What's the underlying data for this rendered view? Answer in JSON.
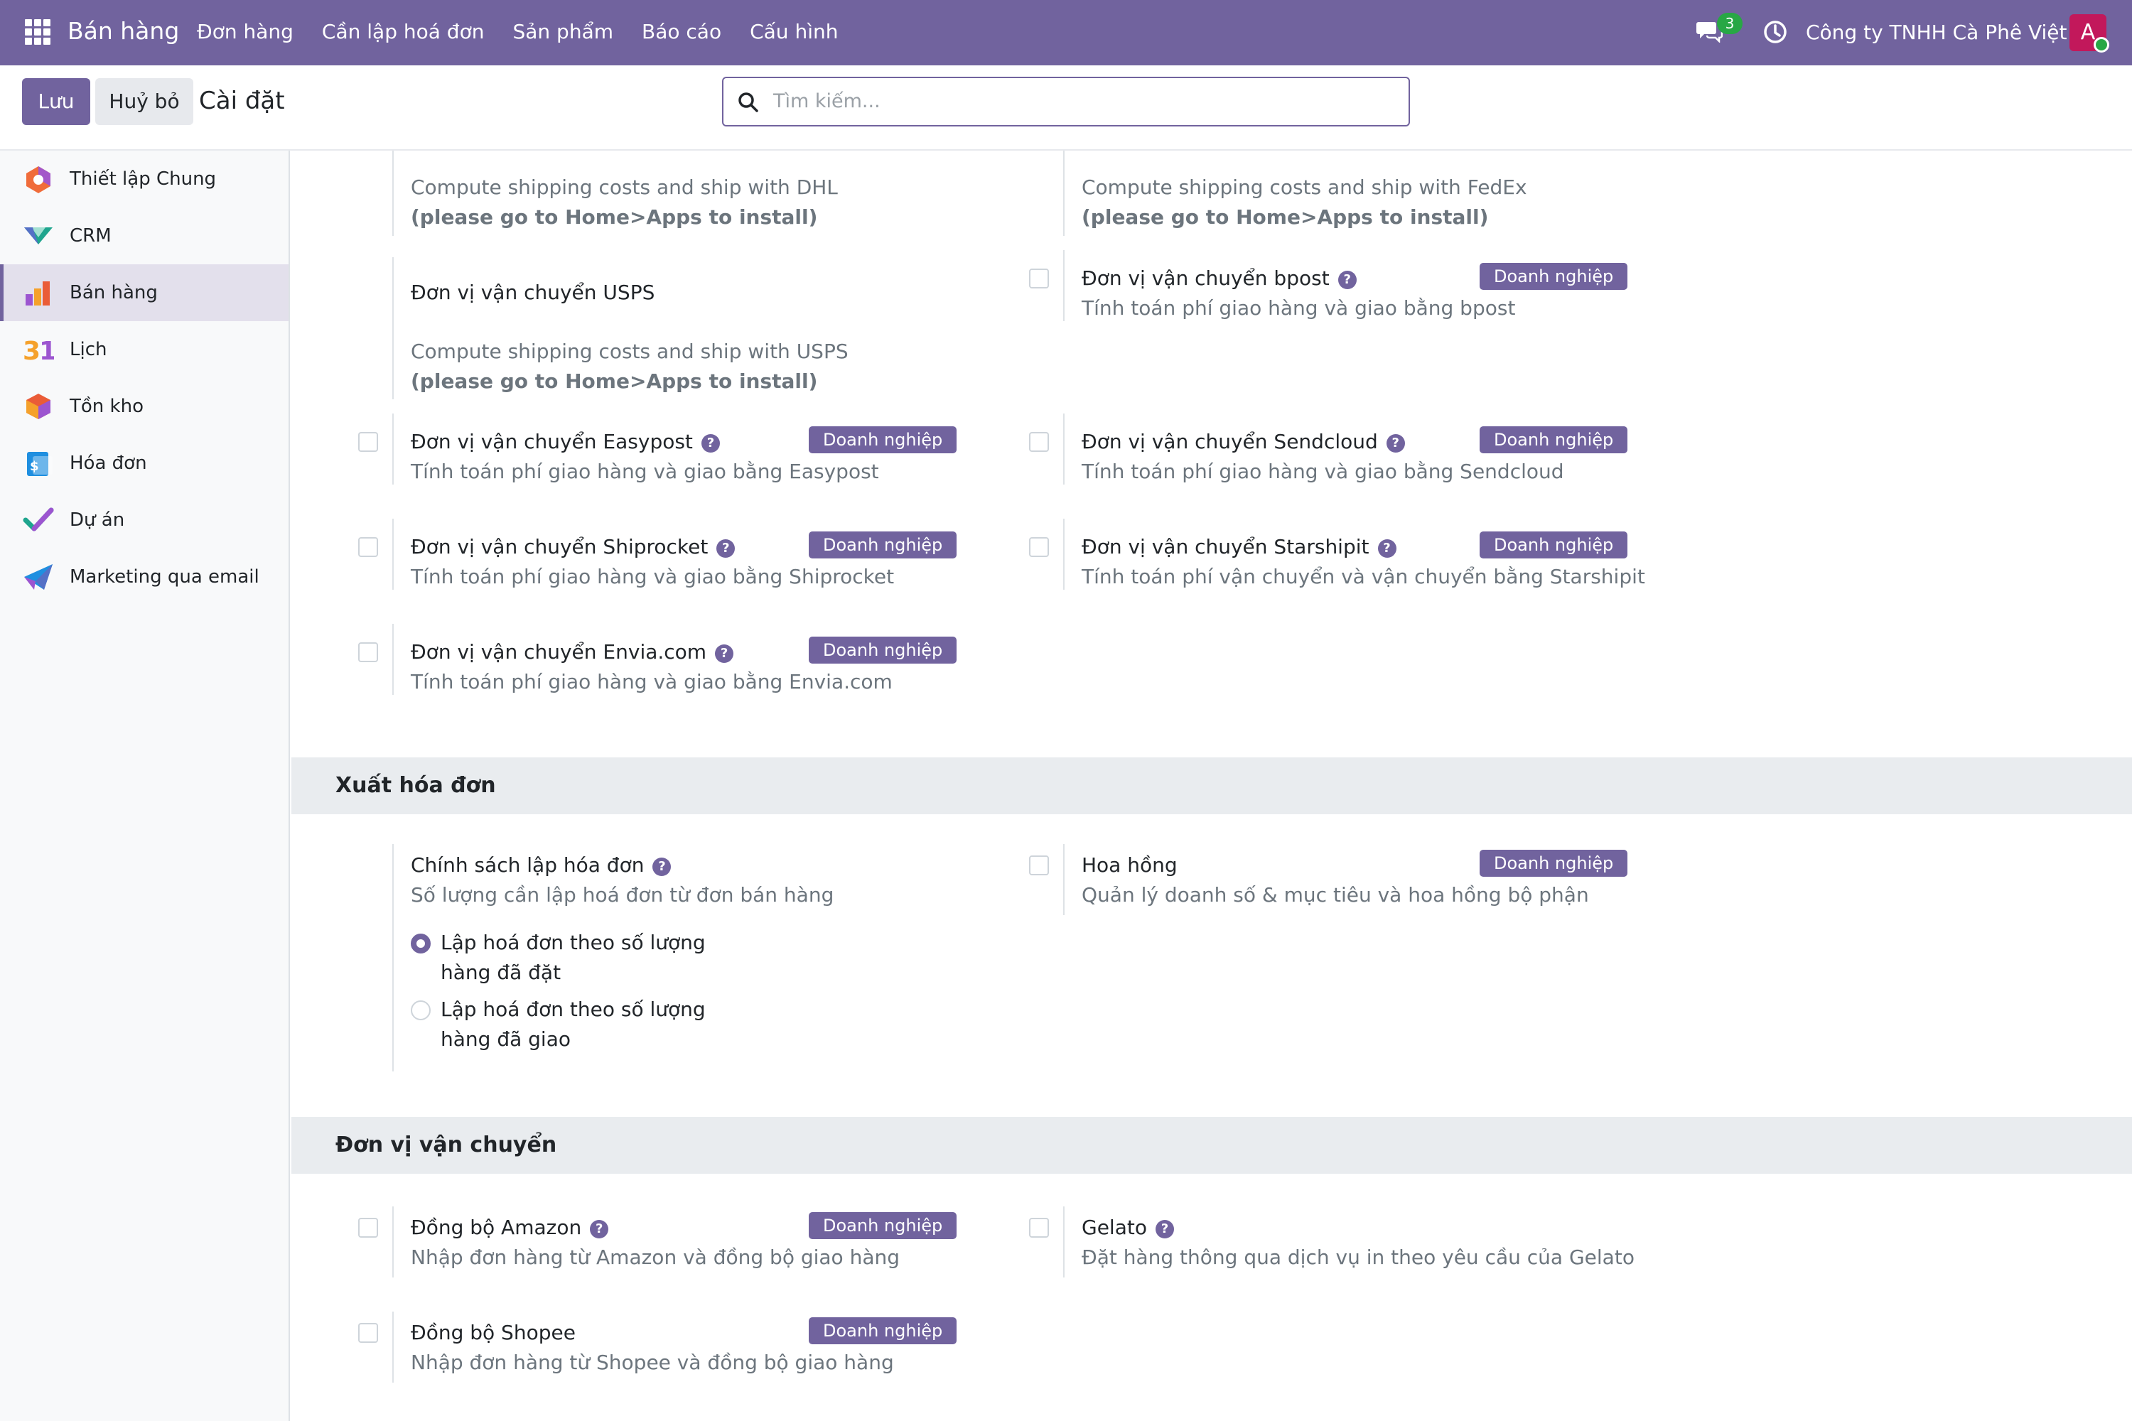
{
  "navbar": {
    "brand": "Bán hàng",
    "menu": [
      "Đơn hàng",
      "Cần lập hoá đơn",
      "Sản phẩm",
      "Báo cáo",
      "Cấu hình"
    ],
    "chat_count": "3",
    "company": "Công ty TNHH Cà Phê Việt",
    "avatar_letter": "A"
  },
  "control": {
    "save_label": "Lưu",
    "cancel_label": "Huỷ bỏ",
    "title": "Cài đặt",
    "search_placeholder": "Tìm kiếm..."
  },
  "sidebar": {
    "items": [
      {
        "label": "Thiết lập Chung",
        "icon": "settings-hexagon-icon"
      },
      {
        "label": "CRM",
        "icon": "crm-icon"
      },
      {
        "label": "Bán hàng",
        "icon": "sales-icon",
        "active": true
      },
      {
        "label": "Lịch",
        "icon": "calendar-icon"
      },
      {
        "label": "Tồn kho",
        "icon": "inventory-icon"
      },
      {
        "label": "Hóa đơn",
        "icon": "invoice-icon"
      },
      {
        "label": "Dự án",
        "icon": "project-icon"
      },
      {
        "label": "Marketing qua email",
        "icon": "email-marketing-icon"
      }
    ]
  },
  "shipping": {
    "dhl_desc": "Compute shipping costs and ship with DHL",
    "dhl_note": "(please go to Home>Apps to install)",
    "fedex_desc": "Compute shipping costs and ship with FedEx",
    "fedex_note": "(please go to Home>Apps to install)",
    "usps_title": "Đơn vị vận chuyển USPS",
    "usps_desc": "Compute shipping costs and ship with USPS",
    "usps_note": "(please go to Home>Apps to install)",
    "bpost_title": "Đơn vị vận chuyển bpost",
    "bpost_desc": "Tính toán phí giao hàng và giao bằng bpost",
    "easypost_title": "Đơn vị vận chuyển Easypost",
    "easypost_desc": "Tính toán phí giao hàng và giao bằng Easypost",
    "sendcloud_title": "Đơn vị vận chuyển Sendcloud",
    "sendcloud_desc": "Tính toán phí giao hàng và giao bằng Sendcloud",
    "shiprocket_title": "Đơn vị vận chuyển Shiprocket",
    "shiprocket_desc": "Tính toán phí giao hàng và giao bằng Shiprocket",
    "starshipit_title": "Đơn vị vận chuyển Starshipit",
    "starshipit_desc": "Tính toán phí vận chuyển và vận chuyển bằng Starshipit",
    "envia_title": "Đơn vị vận chuyển Envia.com",
    "envia_desc": "Tính toán phí giao hàng và giao bằng Envia.com"
  },
  "badge_label": "Doanh nghiệp",
  "invoicing": {
    "header": "Xuất hóa đơn",
    "policy_title": "Chính sách lập hóa đơn",
    "policy_desc": "Số lượng cần lập hoá đơn từ đơn bán hàng",
    "option_ordered": "Lập hoá đơn theo số lượng hàng đã đặt",
    "option_delivered": "Lập hoá đơn theo số lượng hàng đã giao",
    "selected": "ordered",
    "commission_title": "Hoa hồng",
    "commission_desc": "Quản lý doanh số & mục tiêu và hoa hồng bộ phận"
  },
  "connectors": {
    "header": "Đơn vị vận chuyển",
    "amazon_title": "Đồng bộ Amazon",
    "amazon_desc": "Nhập đơn hàng từ Amazon và đồng bộ giao hàng",
    "gelato_title": "Gelato",
    "gelato_desc": "Đặt hàng thông qua dịch vụ in theo yêu cầu của Gelato",
    "shopee_title": "Đồng bộ Shopee",
    "shopee_desc": "Nhập đơn hàng từ Shopee và đồng bộ giao hàng"
  },
  "colors": {
    "primary": "#71639e",
    "badge_green": "#28a745"
  }
}
